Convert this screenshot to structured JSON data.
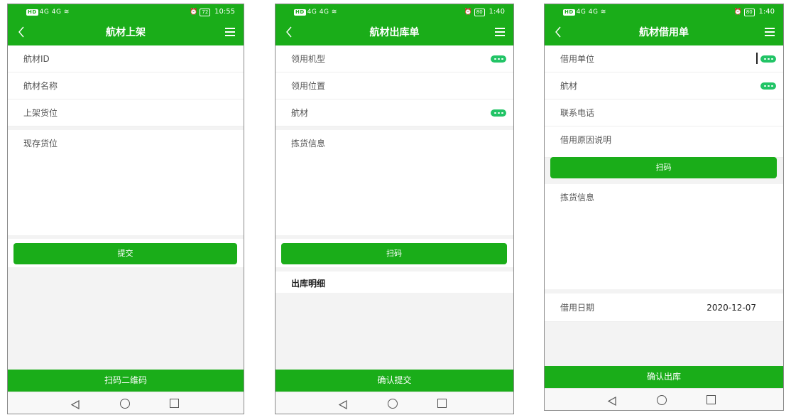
{
  "colors": {
    "brand_green": "#1aad19",
    "more_icon_green": "#22c466"
  },
  "phones": [
    {
      "status": {
        "left": "HD 4G 4G",
        "time": "10:55",
        "battery": "72"
      },
      "nav": {
        "title": "航材上架",
        "back_icon": "chevron-left-icon",
        "menu_icon": "menu-icon"
      },
      "fields": [
        {
          "label": "航材ID"
        },
        {
          "label": "航材名称"
        },
        {
          "label": "上架货位"
        }
      ],
      "textarea_label": "现存货位",
      "main_button": "提交",
      "bottom_action": "扫码二维码"
    },
    {
      "status": {
        "left": "HD 4G 4G",
        "time": "1:40",
        "battery": "80"
      },
      "nav": {
        "title": "航材出库单",
        "back_icon": "chevron-left-icon",
        "menu_icon": "menu-icon"
      },
      "fields": [
        {
          "label": "领用机型",
          "has_more": true
        },
        {
          "label": "领用位置"
        },
        {
          "label": "航材",
          "has_more": true
        }
      ],
      "textarea_label": "拣货信息",
      "main_button": "扫码",
      "section_title": "出库明细",
      "bottom_action": "确认提交"
    },
    {
      "status": {
        "left": "HD 4G 4G",
        "time": "1:40",
        "battery": "80"
      },
      "nav": {
        "title": "航材借用单",
        "back_icon": "chevron-left-icon",
        "menu_icon": "menu-icon"
      },
      "fields": [
        {
          "label": "借用单位",
          "has_more": true
        },
        {
          "label": "航材",
          "has_more": true
        },
        {
          "label": "联系电话"
        },
        {
          "label": "借用原因说明"
        }
      ],
      "main_button": "扫码",
      "textarea_label": "拣货信息",
      "date_label": "借用日期",
      "date_value": "2020-12-07",
      "bottom_action": "确认出库"
    }
  ]
}
